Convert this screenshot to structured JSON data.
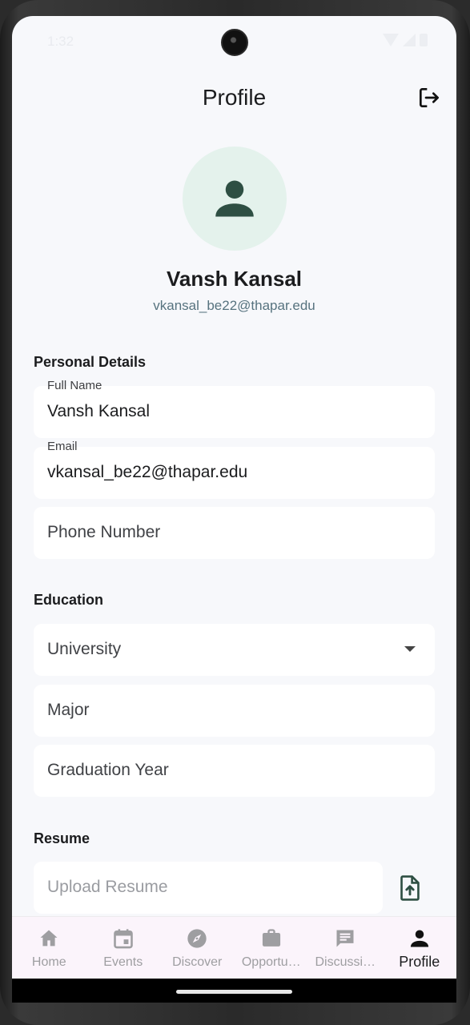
{
  "status_bar": {
    "time": "1:32"
  },
  "app_bar": {
    "title": "Profile",
    "logout_icon": "logout-icon"
  },
  "profile": {
    "avatar_icon": "person-icon",
    "name": "Vansh Kansal",
    "email": "vkansal_be22@thapar.edu"
  },
  "personal_details": {
    "title": "Personal Details",
    "full_name": {
      "label": "Full Name",
      "value": "Vansh Kansal"
    },
    "email": {
      "label": "Email",
      "value": "vkansal_be22@thapar.edu"
    },
    "phone": {
      "placeholder": "Phone Number"
    }
  },
  "education": {
    "title": "Education",
    "university": {
      "placeholder": "University"
    },
    "major": {
      "placeholder": "Major"
    },
    "graduation_year": {
      "placeholder": "Graduation Year"
    }
  },
  "resume": {
    "title": "Resume",
    "upload": {
      "placeholder": "Upload Resume"
    },
    "upload_icon": "file-upload-icon"
  },
  "bottom_nav": {
    "items": [
      {
        "label": "Home",
        "icon": "home-icon"
      },
      {
        "label": "Events",
        "icon": "calendar-icon"
      },
      {
        "label": "Discover",
        "icon": "compass-icon"
      },
      {
        "label": "Opportu…",
        "icon": "briefcase-icon"
      },
      {
        "label": "Discussi…",
        "icon": "chat-icon"
      },
      {
        "label": "Profile",
        "icon": "person-icon",
        "active": true
      }
    ]
  },
  "colors": {
    "accent": "#2e4f43",
    "avatar_bg": "#e4f2ec",
    "background": "#f7f8fb",
    "email_text": "#57737f",
    "nav_bg": "#fbf4fb"
  }
}
